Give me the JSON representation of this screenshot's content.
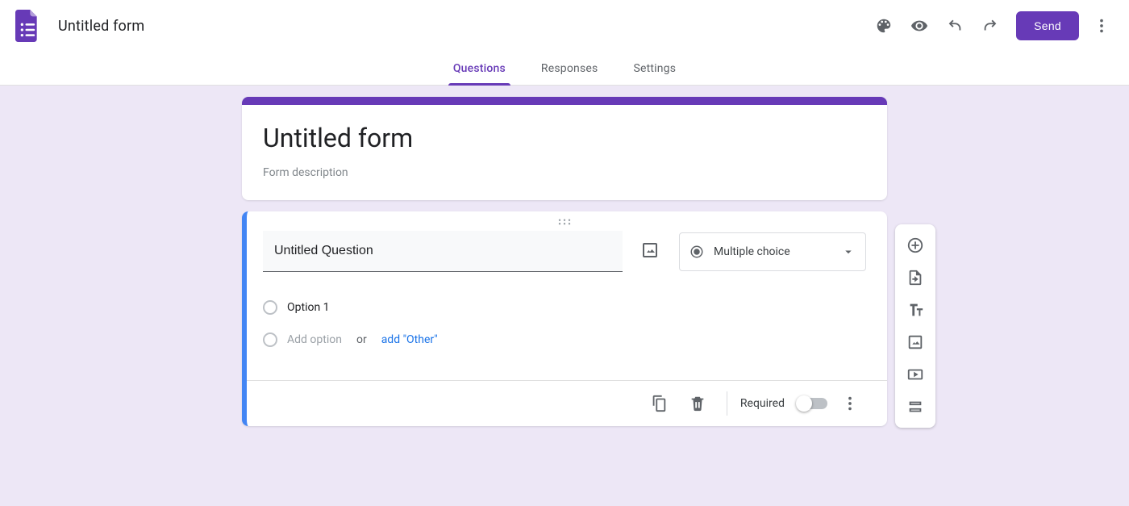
{
  "colors": {
    "accent": "#673ab7",
    "focus_border": "#4285f4",
    "link": "#1a73e8"
  },
  "appbar": {
    "doc_title": "Untitled form",
    "send_label": "Send"
  },
  "tabs": {
    "questions": "Questions",
    "responses": "Responses",
    "settings": "Settings",
    "active": "questions"
  },
  "form_header": {
    "title": "Untitled form",
    "description_placeholder": "Form description"
  },
  "question": {
    "title": "Untitled Question",
    "type_label": "Multiple choice",
    "options": [
      {
        "label": "Option 1"
      }
    ],
    "add_option_placeholder": "Add option",
    "or_text": "or",
    "add_other_label": "add \"Other\"",
    "required_label": "Required",
    "required_value": false
  },
  "side_toolbar": {
    "buttons": [
      "add-question",
      "import-questions",
      "add-title",
      "add-image",
      "add-video",
      "add-section"
    ]
  }
}
